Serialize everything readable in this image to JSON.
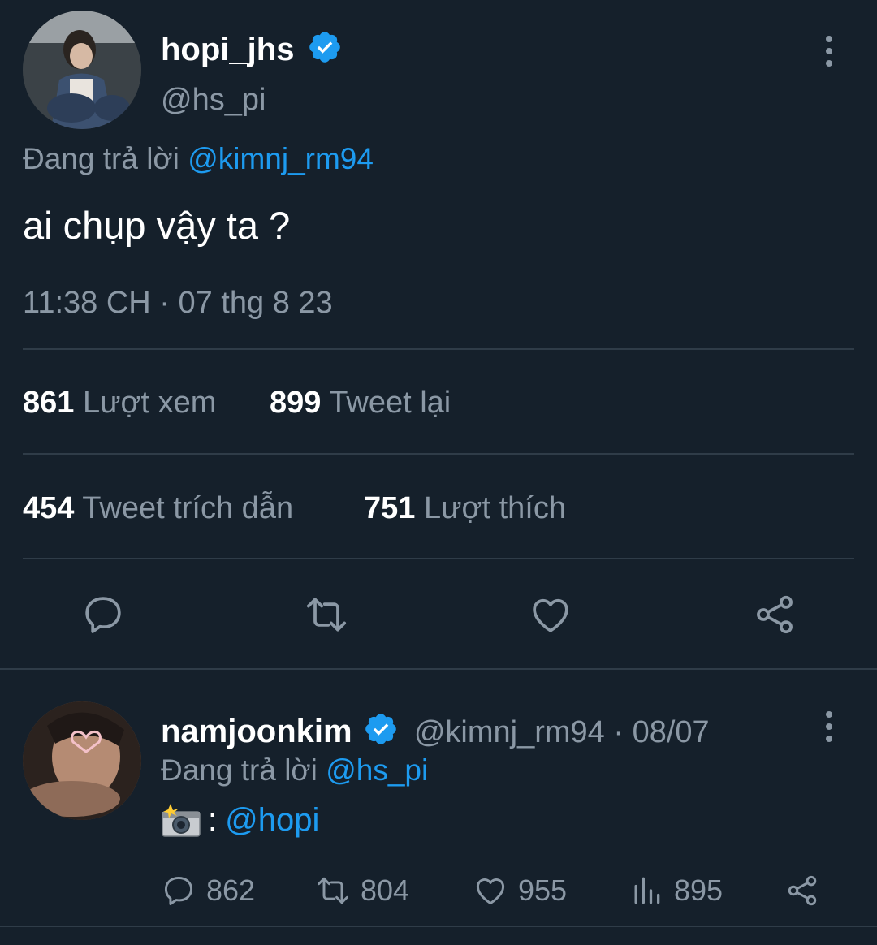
{
  "main_tweet": {
    "display_name": "hopi_jhs",
    "handle": "@hs_pi",
    "reply_prefix": "Đang trả lời",
    "reply_mention": "@kimnj_rm94",
    "text": "ai chụp vậy ta ?",
    "timestamp": "11:38 CH · 07 thg 8 23",
    "stats": {
      "views_count": "861",
      "views_label": "Lượt xem",
      "retweets_count": "899",
      "retweets_label": "Tweet lại",
      "quotes_count": "454",
      "quotes_label": "Tweet trích dẫn",
      "likes_count": "751",
      "likes_label": "Lượt thích"
    },
    "actions": [
      "reply-icon",
      "retweet-icon",
      "like-icon",
      "share-icon"
    ]
  },
  "reply_tweet": {
    "display_name": "namjoonkim",
    "handle_date": "@kimnj_rm94 · 08/07",
    "reply_prefix": "Đang trả lời",
    "reply_mention": "@hs_pi",
    "text_separator": ":",
    "text_mention": "@hopi",
    "emoji": "camera-with-flash-icon",
    "metrics": {
      "replies": "862",
      "retweets": "804",
      "likes": "955",
      "views": "895"
    }
  },
  "colors": {
    "background": "#15202b",
    "primary_text": "#ffffff",
    "secondary_text": "#8b98a5",
    "accent": "#1d9bf0",
    "divider": "#2f3c48"
  }
}
